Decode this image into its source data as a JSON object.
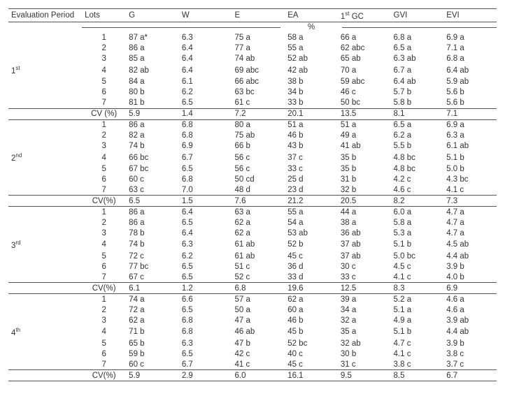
{
  "headers": {
    "period": "Evaluation Period",
    "lots": "Lots",
    "cols": [
      "G",
      "W",
      "E",
      "EA",
      "1",
      "GC",
      "GVI",
      "EVI"
    ],
    "gc_sup": "st",
    "units": "%"
  },
  "periods": [
    {
      "label": "1",
      "sup": "st",
      "rows": [
        {
          "lot": "1",
          "v": [
            "87 a*",
            "6.3",
            "75 a",
            "58 a",
            "66 a",
            "6.8 a",
            "6.9 a"
          ]
        },
        {
          "lot": "2",
          "v": [
            "86 a",
            "6.4",
            "77 a",
            "55 a",
            "62 abc",
            "6.5 a",
            "7.1 a"
          ]
        },
        {
          "lot": "3",
          "v": [
            "85 a",
            "6.4",
            "74 ab",
            "52 ab",
            "65 ab",
            "6.3 ab",
            "6.8 a"
          ]
        },
        {
          "lot": "4",
          "v": [
            "82 ab",
            "6.4",
            "69 abc",
            "42 ab",
            "70 a",
            "6.7 a",
            "6.4 ab"
          ]
        },
        {
          "lot": "5",
          "v": [
            "84 a",
            "6.1",
            "66 abc",
            "38 b",
            "59 abc",
            "6.4 ab",
            "5.9 ab"
          ]
        },
        {
          "lot": "6",
          "v": [
            "80 b",
            "6.2",
            "63 bc",
            "34 b",
            "46 c",
            "5.7 b",
            "5.6 b"
          ]
        },
        {
          "lot": "7",
          "v": [
            "81 b",
            "6.5",
            "61 c",
            "33 b",
            "50 bc",
            "5.8 b",
            "5.6 b"
          ]
        }
      ],
      "cv_label": "CV (%)",
      "cv": [
        "5.9",
        "1.4",
        "7.2",
        "20.1",
        "13.5",
        "8.1",
        "7.1"
      ]
    },
    {
      "label": "2",
      "sup": "nd",
      "rows": [
        {
          "lot": "1",
          "v": [
            "86 a",
            "6.8",
            "80 a",
            "51 a",
            "51 a",
            "6.5 a",
            "6.9 a"
          ]
        },
        {
          "lot": "2",
          "v": [
            "82 a",
            "6.8",
            "75 ab",
            "46 b",
            "49 a",
            "6.2 a",
            "6.3 a"
          ]
        },
        {
          "lot": "3",
          "v": [
            "74 b",
            "6.9",
            "66 b",
            "43 b",
            "41 ab",
            "5.5 b",
            "6.1 ab"
          ]
        },
        {
          "lot": "4",
          "v": [
            "66 bc",
            "6.7",
            "56 c",
            "37 c",
            "35 b",
            "4.8 bc",
            "5.1 b"
          ]
        },
        {
          "lot": "5",
          "v": [
            "67 bc",
            "6.5",
            "56 c",
            "33 c",
            "35 b",
            "4.8 bc",
            "5.0 b"
          ]
        },
        {
          "lot": "6",
          "v": [
            "60 c",
            "6.8",
            "50 cd",
            "25 d",
            "31 b",
            "4.2 c",
            "4.3 bc"
          ]
        },
        {
          "lot": "7",
          "v": [
            "63 c",
            "7.0",
            "48 d",
            "23 d",
            "32 b",
            "4.6 c",
            "4.1 c"
          ]
        }
      ],
      "cv_label": "CV(%)",
      "cv": [
        "6.5",
        "1.5",
        "7.6",
        "21.2",
        "20.5",
        "8.2",
        "7.3"
      ]
    },
    {
      "label": "3",
      "sup": "rd",
      "rows": [
        {
          "lot": "1",
          "v": [
            "86 a",
            "6.4",
            "63 a",
            "55 a",
            "44 a",
            "6.0 a",
            "4.7 a"
          ]
        },
        {
          "lot": "2",
          "v": [
            "86 a",
            "6.5",
            "62 a",
            "54 a",
            "38 a",
            "5.8 a",
            "4.7 a"
          ]
        },
        {
          "lot": "3",
          "v": [
            "78 b",
            "6.4",
            "62 a",
            "53 ab",
            "36 ab",
            "5.3 a",
            "4.7 a"
          ]
        },
        {
          "lot": "4",
          "v": [
            "74 b",
            "6.3",
            "61 ab",
            "52 b",
            "37 ab",
            "5.1 b",
            "4.5 ab"
          ]
        },
        {
          "lot": "5",
          "v": [
            "72 c",
            "6.2",
            "61 ab",
            "45 c",
            "37 ab",
            "5.0 bc",
            "4.4 ab"
          ]
        },
        {
          "lot": "6",
          "v": [
            "77 bc",
            "6.5",
            "51 c",
            "36 d",
            "30 c",
            "4.5 c",
            "3.9 b"
          ]
        },
        {
          "lot": "7",
          "v": [
            "67 c",
            "6.5",
            "52 c",
            "33 d",
            "33 c",
            "4.1 c",
            "4.0 b"
          ]
        }
      ],
      "cv_label": "CV(%)",
      "cv": [
        "6.1",
        "1.2",
        "6.8",
        "19.6",
        "12.5",
        "8.3",
        "6.9"
      ]
    },
    {
      "label": "4",
      "sup": "th",
      "rows": [
        {
          "lot": "1",
          "v": [
            "74 a",
            "6.6",
            "57 a",
            "62 a",
            "39 a",
            "5.2 a",
            "4.6 a"
          ]
        },
        {
          "lot": "2",
          "v": [
            "72 a",
            "6.5",
            "50 a",
            "60 a",
            "34 a",
            "5.1 a",
            "4.6 a"
          ]
        },
        {
          "lot": "3",
          "v": [
            "62 a",
            "6.8",
            "47 a",
            "46 b",
            "32 a",
            "4.9 a",
            "3.9 ab"
          ]
        },
        {
          "lot": "4",
          "v": [
            "71 b",
            "6.8",
            "46 ab",
            "45 b",
            "35 a",
            "5.1 b",
            "4.4 ab"
          ]
        },
        {
          "lot": "5",
          "v": [
            "65 b",
            "6.3",
            "47 b",
            "52 bc",
            "32 ab",
            "4.7 c",
            "3.9 b"
          ]
        },
        {
          "lot": "6",
          "v": [
            "59 b",
            "6.5",
            "42 c",
            "40 c",
            "30 b",
            "4.1 c",
            "3.8 c"
          ]
        },
        {
          "lot": "7",
          "v": [
            "60 c",
            "6.7",
            "41 c",
            "45 c",
            "31 c",
            "3.8 c",
            "3.7 c"
          ]
        }
      ],
      "cv_label": "CV(%)",
      "cv": [
        "5.9",
        "2.9",
        "6.0",
        "16.1",
        "9.5",
        "8.5",
        "6.7"
      ]
    }
  ]
}
